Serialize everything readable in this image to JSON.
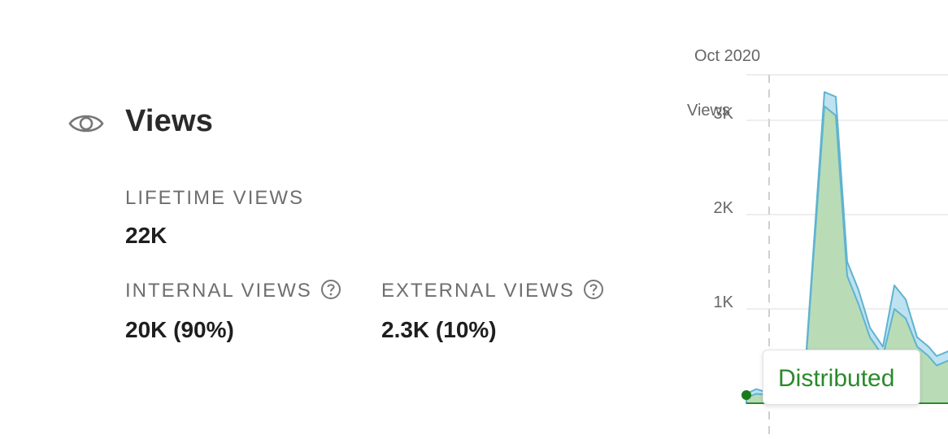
{
  "views_panel": {
    "title": "Views",
    "icon": "eye-icon",
    "lifetime": {
      "label": "LIFETIME VIEWS",
      "value": "22K"
    },
    "internal": {
      "label": "INTERNAL VIEWS",
      "value": "20K (90%)",
      "icon": "help-icon"
    },
    "external": {
      "label": "EXTERNAL VIEWS",
      "value": "2.3K (10%)",
      "icon": "help-icon"
    }
  },
  "chart_data": {
    "type": "area",
    "x_label_top": "Oct 2020",
    "ylabel": "Views",
    "yticks": [
      "3K",
      "2K",
      "1K"
    ],
    "ylim": [
      0,
      3500
    ],
    "grid": true,
    "series": [
      {
        "color": "#a8d8ea",
        "values": [
          100,
          150,
          120,
          80,
          60,
          80,
          3300,
          3250,
          1500,
          1200,
          800,
          600,
          1250,
          1100,
          700,
          600,
          500,
          550,
          450
        ]
      },
      {
        "color": "#b8dbb0",
        "values": [
          60,
          100,
          90,
          60,
          40,
          60,
          3150,
          3050,
          1350,
          1050,
          700,
          500,
          1000,
          900,
          600,
          500,
          400,
          450,
          350
        ]
      }
    ],
    "colors": {
      "area_fill": "#c5e3bf",
      "line": "#5fb3d0",
      "marker": "#1a7a1a"
    },
    "tooltip": "Distributed"
  }
}
